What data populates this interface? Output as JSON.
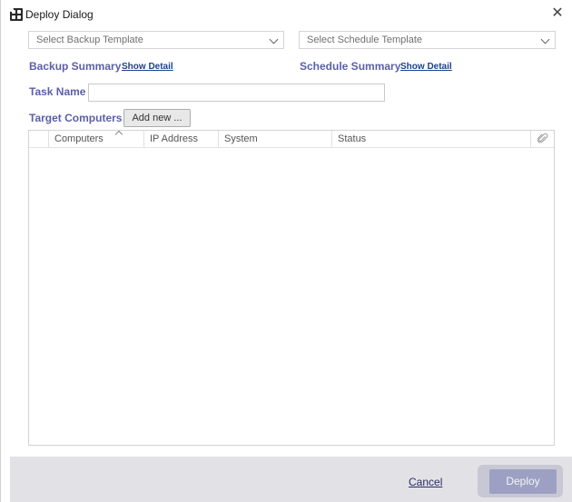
{
  "window": {
    "title": "Deploy Dialog",
    "close_glyph": "✕"
  },
  "backup_template": {
    "placeholder": "Select Backup Template"
  },
  "schedule_template": {
    "placeholder": "Select Schedule Template"
  },
  "backup_summary": {
    "label": "Backup Summary",
    "link": "Show Detail"
  },
  "schedule_summary": {
    "label": "Schedule Summary",
    "link": "Show Detail"
  },
  "task": {
    "label": "Task Name",
    "value": ""
  },
  "targets": {
    "label": "Target Computers",
    "add_button": "Add new ...",
    "columns": [
      "Computers",
      "IP Address",
      "System",
      "Status"
    ],
    "rows": []
  },
  "footer": {
    "cancel": "Cancel",
    "deploy": "Deploy"
  },
  "colors": {
    "label_accent": "#5b5fa8",
    "link": "#1f3f8f",
    "deploy_button": "#9da0c2",
    "footer_bg": "#e2e2e6"
  },
  "icons": {
    "app": "app-grid-icon",
    "close": "close-icon",
    "dropdown": "chevron-down-icon",
    "sort": "sort-ascending-icon",
    "attach": "paperclip-icon"
  }
}
